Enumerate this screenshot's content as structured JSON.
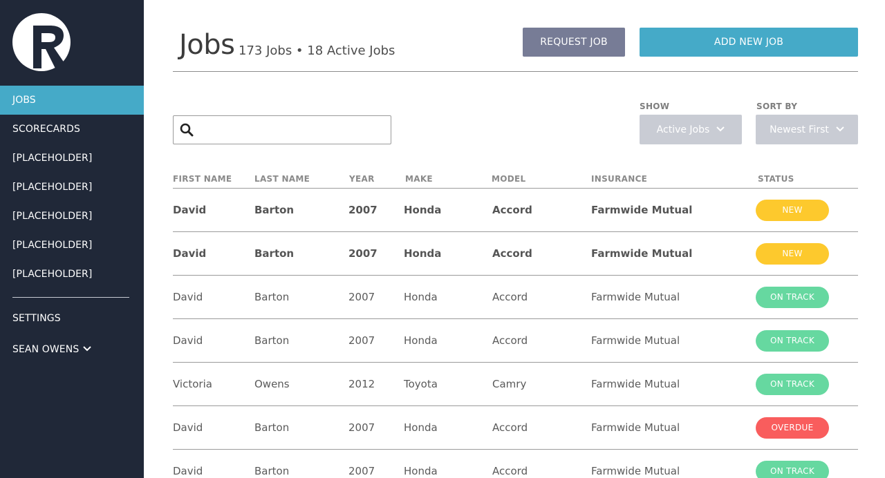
{
  "colors": {
    "sidebar_bg": "#202838",
    "accent": "#45aac8",
    "request_button": "#777c96",
    "select_bg": "#c9ccd4",
    "status_new": "#fdc92d",
    "status_on_track": "#66d8a0",
    "status_overdue": "#f95d5d"
  },
  "sidebar": {
    "logo_icon": "r-logo-icon",
    "items": [
      {
        "label": "JOBS",
        "active": true
      },
      {
        "label": "SCORECARDS"
      },
      {
        "label": "[PLACEHOLDER]"
      },
      {
        "label": "[PLACEHOLDER]"
      },
      {
        "label": "[PLACEHOLDER]"
      },
      {
        "label": "[PLACEHOLDER]"
      },
      {
        "label": "[PLACEHOLDER]"
      }
    ],
    "settings_label": "SETTINGS",
    "user_label": "SEAN OWENS",
    "user_icon": "chevron-down-icon"
  },
  "header": {
    "title": "Jobs",
    "subtitle": "173 Jobs • 18 Active Jobs",
    "request_button": "REQUEST JOB",
    "add_button": "ADD NEW JOB"
  },
  "filters": {
    "search_placeholder": "",
    "search_icon": "search-icon",
    "show_label": "SHOW",
    "show_value": "Active Jobs",
    "sort_label": "SORT BY",
    "sort_value": "Newest First"
  },
  "table": {
    "columns": [
      "FIRST NAME",
      "LAST NAME",
      "YEAR",
      "MAKE",
      "MODEL",
      "INSURANCE",
      "STATUS"
    ],
    "rows": [
      {
        "first": "David",
        "last": "Barton",
        "year": "2007",
        "make": "Honda",
        "model": "Accord",
        "insurance": "Farmwide Mutual",
        "status": "NEW",
        "status_type": "new",
        "bold": true
      },
      {
        "first": "David",
        "last": "Barton",
        "year": "2007",
        "make": "Honda",
        "model": "Accord",
        "insurance": "Farmwide Mutual",
        "status": "NEW",
        "status_type": "new",
        "bold": true
      },
      {
        "first": "David",
        "last": "Barton",
        "year": "2007",
        "make": "Honda",
        "model": "Accord",
        "insurance": "Farmwide Mutual",
        "status": "ON TRACK",
        "status_type": "on_track",
        "bold": false
      },
      {
        "first": "David",
        "last": "Barton",
        "year": "2007",
        "make": "Honda",
        "model": "Accord",
        "insurance": "Farmwide Mutual",
        "status": "ON TRACK",
        "status_type": "on_track",
        "bold": false
      },
      {
        "first": "Victoria",
        "last": "Owens",
        "year": "2012",
        "make": "Toyota",
        "model": "Camry",
        "insurance": "Farmwide Mutual",
        "status": "ON TRACK",
        "status_type": "on_track",
        "bold": false
      },
      {
        "first": "David",
        "last": "Barton",
        "year": "2007",
        "make": "Honda",
        "model": "Accord",
        "insurance": "Farmwide Mutual",
        "status": "OVERDUE",
        "status_type": "overdue",
        "bold": false
      },
      {
        "first": "David",
        "last": "Barton",
        "year": "2007",
        "make": "Honda",
        "model": "Accord",
        "insurance": "Farmwide Mutual",
        "status": "ON TRACK",
        "status_type": "on_track",
        "bold": false
      }
    ]
  }
}
